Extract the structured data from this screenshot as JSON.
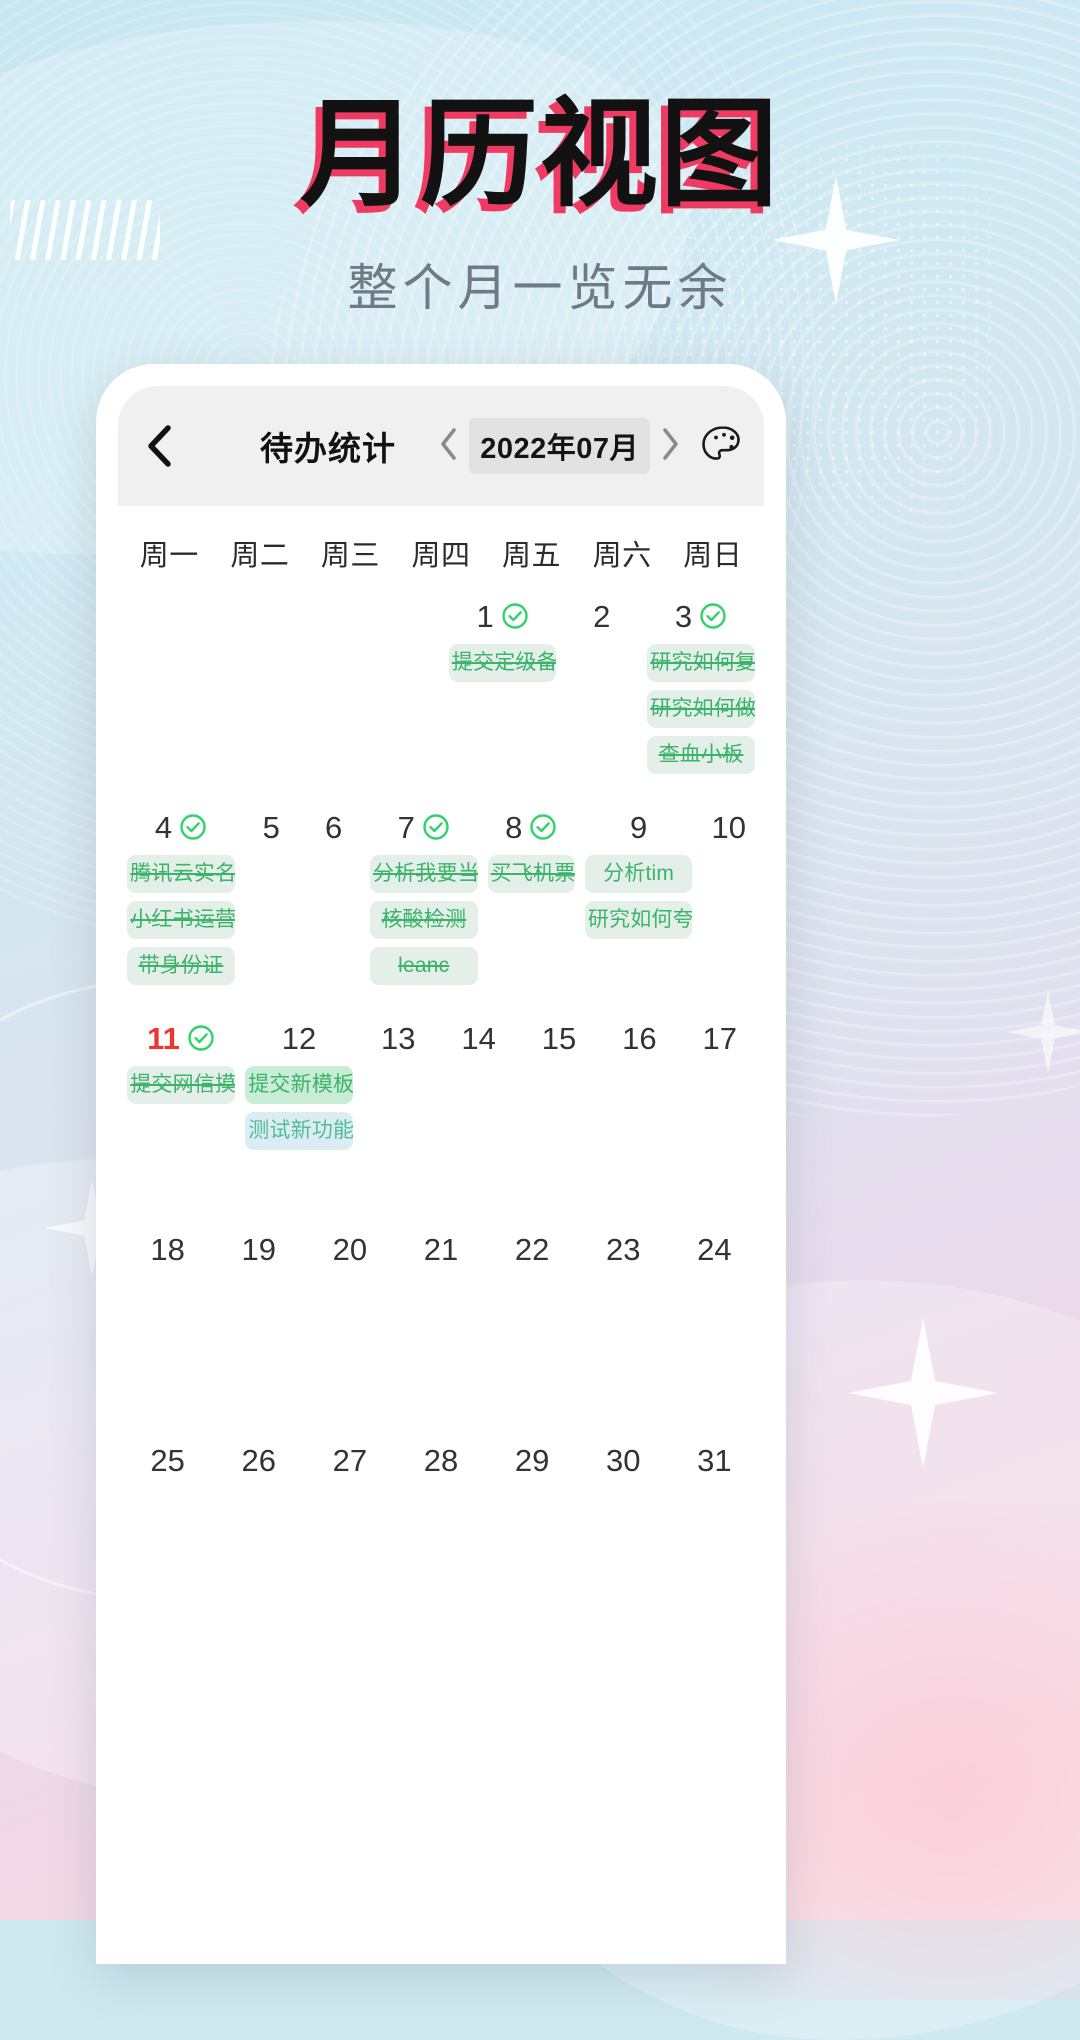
{
  "hero": {
    "title": "月历视图",
    "subtitle": "整个月一览无余",
    "title_color": "#121212",
    "title_shadow_color": "#ef3b62",
    "subtitle_color": "#6f7a86"
  },
  "app": {
    "header": {
      "back_icon": "chevron-left-icon",
      "title": "待办统计",
      "prev_month_icon": "chevron-left-icon",
      "month_label": "2022年07月",
      "next_month_icon": "chevron-right-icon",
      "theme_icon": "palette-icon"
    },
    "weekdays": [
      "周一",
      "周二",
      "周三",
      "周四",
      "周五",
      "周六",
      "周日"
    ],
    "accent_green": "#3bb46a",
    "today_color": "#f0342f",
    "weeks": [
      [
        {
          "day": "",
          "done": false,
          "tasks": []
        },
        {
          "day": "",
          "done": false,
          "tasks": []
        },
        {
          "day": "",
          "done": false,
          "tasks": []
        },
        {
          "day": "",
          "done": false,
          "tasks": []
        },
        {
          "day": "1",
          "done": true,
          "tasks": [
            {
              "text": "提交定级备",
              "style": "done"
            }
          ]
        },
        {
          "day": "2",
          "done": false,
          "tasks": []
        },
        {
          "day": "3",
          "done": true,
          "tasks": [
            {
              "text": "研究如何复",
              "style": "done"
            },
            {
              "text": "研究如何做",
              "style": "done"
            },
            {
              "text": "查血小板",
              "style": "done"
            }
          ]
        }
      ],
      [
        {
          "day": "4",
          "done": true,
          "tasks": [
            {
              "text": "腾讯云实名",
              "style": "done"
            },
            {
              "text": "小红书运营",
              "style": "done"
            },
            {
              "text": "带身份证",
              "style": "done"
            }
          ]
        },
        {
          "day": "5",
          "done": false,
          "tasks": []
        },
        {
          "day": "6",
          "done": false,
          "tasks": []
        },
        {
          "day": "7",
          "done": true,
          "tasks": [
            {
              "text": "分析我要当",
              "style": "done"
            },
            {
              "text": "核酸检测",
              "style": "done"
            },
            {
              "text": "leanc",
              "style": "done"
            }
          ]
        },
        {
          "day": "8",
          "done": true,
          "tasks": [
            {
              "text": "买飞机票",
              "style": "done"
            }
          ]
        },
        {
          "day": "9",
          "done": false,
          "tasks": [
            {
              "text": "分析tim",
              "style": "plain"
            },
            {
              "text": "研究如何夸",
              "style": "plain"
            }
          ]
        },
        {
          "day": "10",
          "done": false,
          "tasks": []
        }
      ],
      [
        {
          "day": "11",
          "done": true,
          "today": true,
          "tasks": [
            {
              "text": "提交网信摸",
              "style": "done"
            }
          ]
        },
        {
          "day": "12",
          "done": false,
          "tasks": [
            {
              "text": "提交新模板",
              "style": "active"
            },
            {
              "text": "测试新功能",
              "style": "blue"
            }
          ]
        },
        {
          "day": "13",
          "done": false,
          "tasks": []
        },
        {
          "day": "14",
          "done": false,
          "tasks": []
        },
        {
          "day": "15",
          "done": false,
          "tasks": []
        },
        {
          "day": "16",
          "done": false,
          "tasks": []
        },
        {
          "day": "17",
          "done": false,
          "tasks": []
        }
      ],
      [
        {
          "day": "18",
          "done": false,
          "tasks": []
        },
        {
          "day": "19",
          "done": false,
          "tasks": []
        },
        {
          "day": "20",
          "done": false,
          "tasks": []
        },
        {
          "day": "21",
          "done": false,
          "tasks": []
        },
        {
          "day": "22",
          "done": false,
          "tasks": []
        },
        {
          "day": "23",
          "done": false,
          "tasks": []
        },
        {
          "day": "24",
          "done": false,
          "tasks": []
        }
      ],
      [
        {
          "day": "25",
          "done": false,
          "tasks": []
        },
        {
          "day": "26",
          "done": false,
          "tasks": []
        },
        {
          "day": "27",
          "done": false,
          "tasks": []
        },
        {
          "day": "28",
          "done": false,
          "tasks": []
        },
        {
          "day": "29",
          "done": false,
          "tasks": []
        },
        {
          "day": "30",
          "done": false,
          "tasks": []
        },
        {
          "day": "31",
          "done": false,
          "tasks": []
        }
      ]
    ]
  }
}
